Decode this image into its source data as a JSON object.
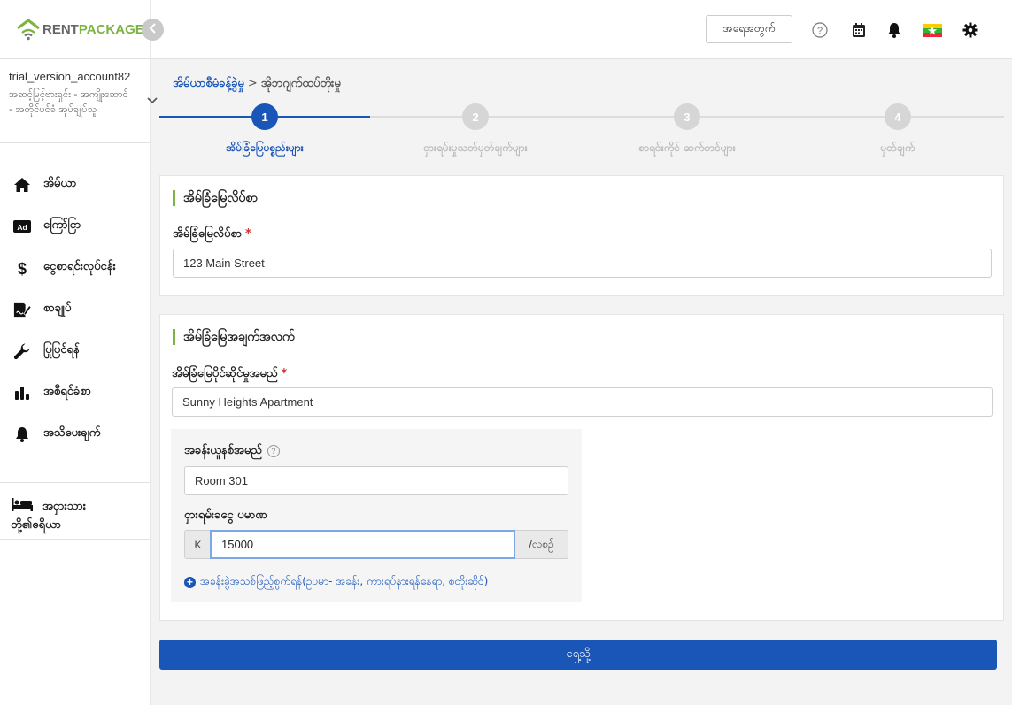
{
  "brand": {
    "part1": "RENT",
    "part2": "PACKAGE",
    "accent": "#7cb342",
    "primary": "#1a56b8"
  },
  "account": {
    "name": "trial_version_account82",
    "role": "အဆင့်မြင့်ဗားရှင်း - အကျိုးဆောင် - အတိုင်ပင်ခံ အုပ်ချုပ်သူ"
  },
  "sidebar": {
    "items": [
      {
        "label": "အိမ်ယာ",
        "icon": "home-icon"
      },
      {
        "label": "ကြော်ငြာ",
        "icon": "ad-icon"
      },
      {
        "label": "ငွေစာရင်းလုပ်ငန်း",
        "icon": "dollar-icon"
      },
      {
        "label": "စာချုပ်",
        "icon": "contract-icon"
      },
      {
        "label": "ပြုပြင်ရန်",
        "icon": "wrench-icon"
      },
      {
        "label": "အစီရင်ခံစာ",
        "icon": "bar-chart-icon"
      },
      {
        "label": "အသိပေးချက်",
        "icon": "bell-icon"
      }
    ],
    "tenants": {
      "label": "အငှားသား တို့၏ဧရိယာ",
      "icon": "bed-icon"
    }
  },
  "header": {
    "signout_label": "အရေအတွက်",
    "icons": [
      "help-icon",
      "calendar-icon",
      "notification-bell-icon",
      "myanmar-flag-icon",
      "settings-gear-icon"
    ]
  },
  "breadcrumb": {
    "parent": "အိမ်ယာစီမံခန့်ခွဲမှု",
    "separator": ">",
    "current": "အိုဘဂျက်ထပ်တိုးမှု"
  },
  "steps": [
    {
      "number": "1",
      "label": "အိမ်ခြံမြေပစ္စည်းများ",
      "active": true
    },
    {
      "number": "2",
      "label": "ငှားရမ်းမှုသတ်မှတ်ချက်များ",
      "active": false
    },
    {
      "number": "3",
      "label": "စာရင်းကိုင် ဆက်တင်များ",
      "active": false
    },
    {
      "number": "4",
      "label": "မှတ်ချက်",
      "active": false
    }
  ],
  "address_card": {
    "title": "အိမ်ခြံမြေလိပ်စာ",
    "field_label": "အိမ်ခြံမြေလိပ်စာ",
    "required": "*",
    "value": "123 Main Street"
  },
  "details_card": {
    "title": "အိမ်ခြံမြေအချက်အလက်",
    "owner_label": "အိမ်ခြံမြေပိုင်ဆိုင်မှုအမည်",
    "required": "*",
    "owner_value": "Sunny Heights Apartment",
    "room_label": "အခန်းယူနစ်အမည်",
    "room_help": "?",
    "room_value": "Room 301",
    "rent_label": "ငှားရမ်းခငွေ ပမာဏ",
    "currency": "K",
    "rent_value": "15000",
    "per_month": "/လစဉ်",
    "add_room_label": "အခန်းခွဲအသစ်ဖြည့်စွက်ရန်(ဥပမာ- အခန်း, ကားရပ်နားရန်နေရာ, စတိုးဆိုင်)"
  },
  "submit_label": "ရှေ့သို့"
}
